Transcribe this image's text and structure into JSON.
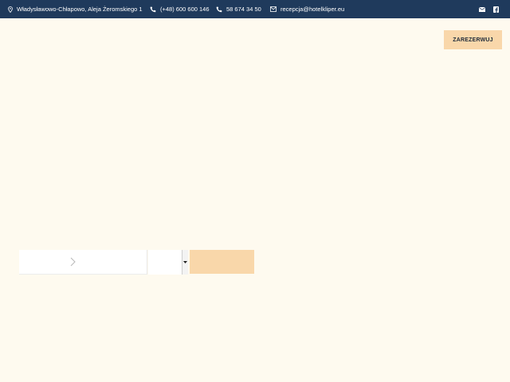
{
  "topbar": {
    "address": "Władysławowo-Chłapowo, Aleja Żeromskiego 1",
    "phone1": "(+48) 600 600 146",
    "phone2": "58 674 34 50",
    "email": "recepcja@hotelkliper.eu",
    "icons": [
      "map-pin-icon",
      "phone-icon",
      "phone-icon",
      "envelope-icon",
      "mail-icon",
      "facebook-icon"
    ]
  },
  "header": {
    "reserve_label": "ZAREZERWUJ"
  },
  "colors": {
    "topbar_bg": "#1f3a5c",
    "page_bg": "#fefaef",
    "accent": "#f9d7aa"
  }
}
